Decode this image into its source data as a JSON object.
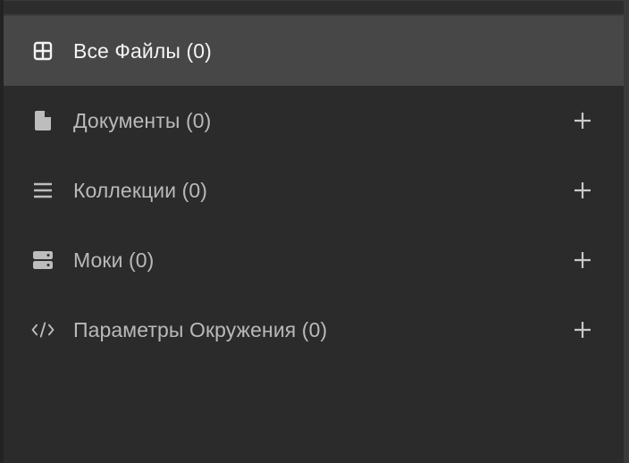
{
  "sidebar": {
    "items": [
      {
        "label": "Все Файлы (0)",
        "icon": "grid-icon",
        "active": true,
        "addable": false
      },
      {
        "label": "Документы (0)",
        "icon": "document-icon",
        "active": false,
        "addable": true
      },
      {
        "label": "Коллекции (0)",
        "icon": "list-icon",
        "active": false,
        "addable": true
      },
      {
        "label": "Моки (0)",
        "icon": "server-icon",
        "active": false,
        "addable": true
      },
      {
        "label": "Параметры Окружения (0)",
        "icon": "code-icon",
        "active": false,
        "addable": true
      }
    ],
    "add_icon": "plus-icon"
  },
  "colors": {
    "background": "#2b2b2b",
    "active_background": "#474747",
    "text": "#b9b9b9",
    "active_text": "#f4f4f4"
  }
}
